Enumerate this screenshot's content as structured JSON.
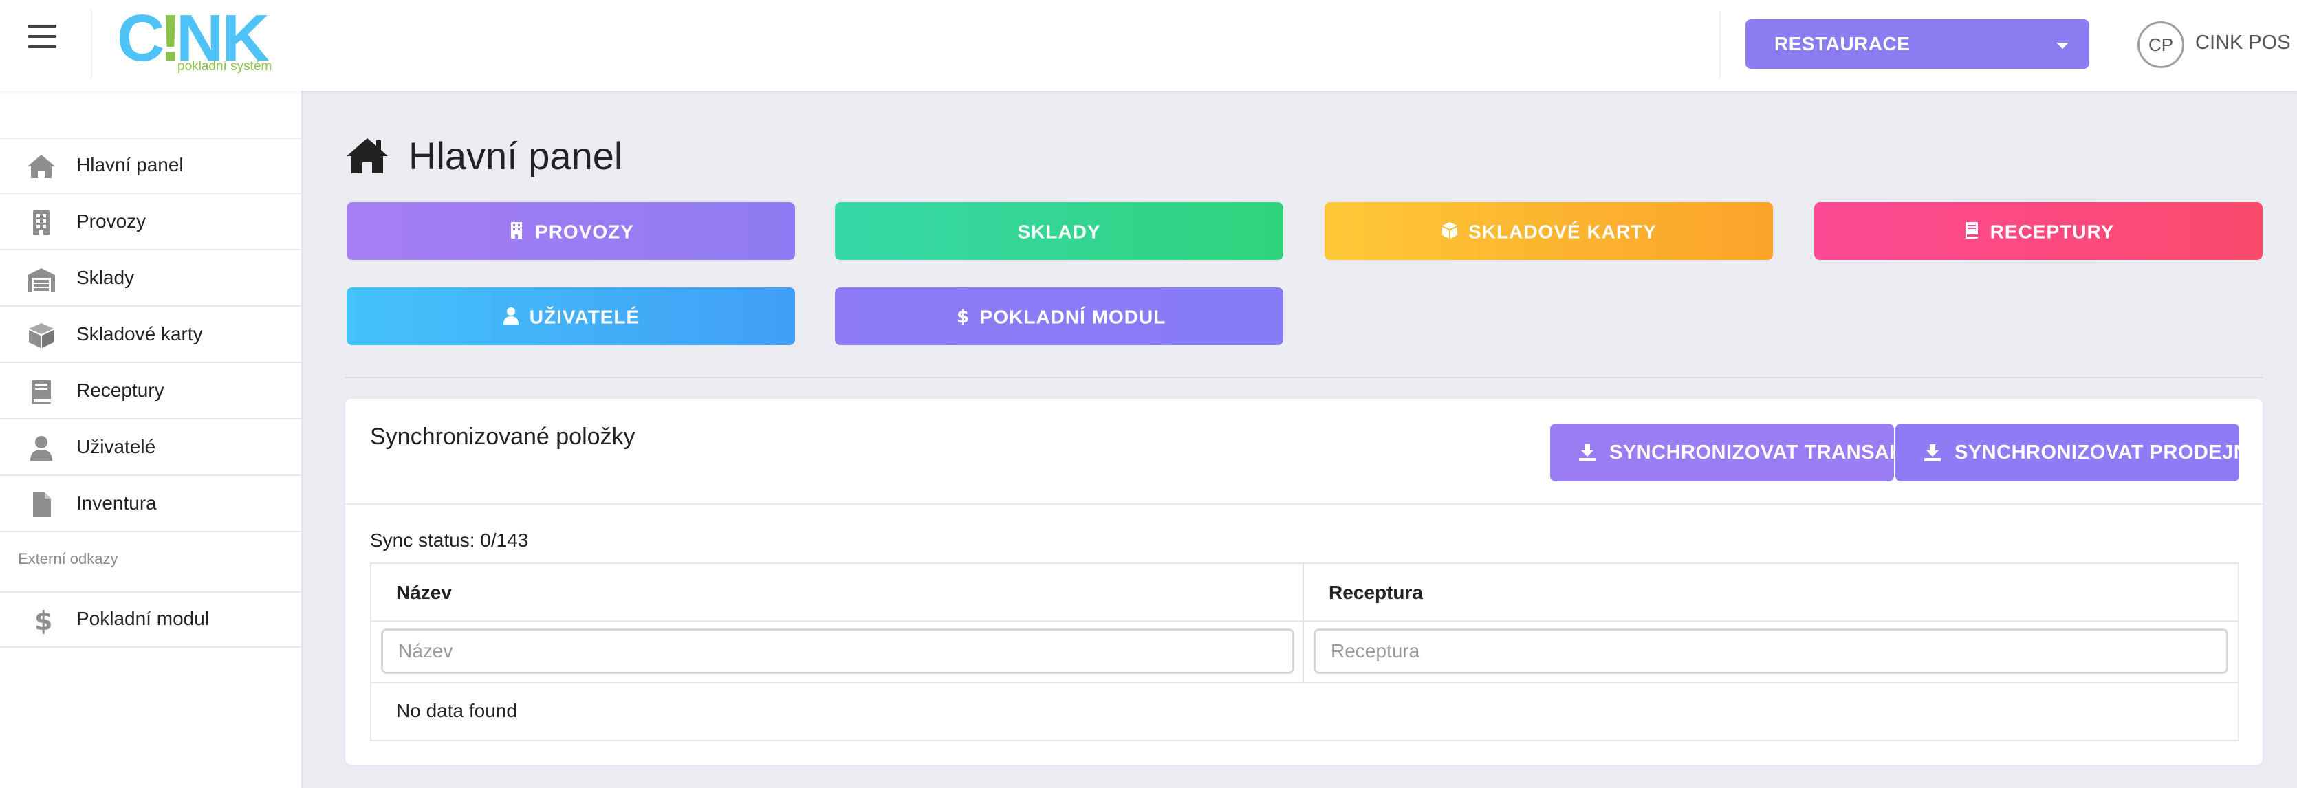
{
  "header": {
    "logo_text": "C!NK",
    "logo_tagline": "pokladní systém",
    "venue": "RESTAURACE",
    "user_initials": "CP",
    "user_name": "CINK POS"
  },
  "sidebar": {
    "items": [
      {
        "label": "Hlavní panel",
        "icon": "home-icon"
      },
      {
        "label": "Provozy",
        "icon": "building-icon"
      },
      {
        "label": "Sklady",
        "icon": "warehouse-icon"
      },
      {
        "label": "Skladové karty",
        "icon": "box-icon"
      },
      {
        "label": "Receptury",
        "icon": "book-icon"
      },
      {
        "label": "Uživatelé",
        "icon": "user-icon"
      },
      {
        "label": "Inventura",
        "icon": "file-icon"
      }
    ],
    "section_label": "Externí odkazy",
    "external_items": [
      {
        "label": "Pokladní modul",
        "icon": "dollar-icon"
      }
    ]
  },
  "page": {
    "title": "Hlavní panel"
  },
  "quick_buttons": [
    {
      "label": "PROVOZY",
      "icon": "building-icon",
      "color": "#9a7cf3"
    },
    {
      "label": "SKLADY",
      "icon": "",
      "color": "#34d39a"
    },
    {
      "label": "SKLADOVÉ KARTY",
      "icon": "box-icon",
      "color": "#fdb22f"
    },
    {
      "label": "RECEPTURY",
      "icon": "book-icon",
      "color": "#fb4a86"
    },
    {
      "label": "UŽIVATELÉ",
      "icon": "user-icon",
      "color": "#43b0f8"
    },
    {
      "label": "POKLADNÍ MODUL",
      "icon": "dollar-icon",
      "color": "#8a7cf5"
    }
  ],
  "sync_card": {
    "title": "Synchronizované položky",
    "btn_transactions": "SYNCHRONIZOVAT TRANSAKCE",
    "btn_products": "SYNCHRONIZOVAT PRODEJNÍ POLOŽKY",
    "status": "Sync status: 0/143",
    "columns": [
      "Název",
      "Receptura"
    ],
    "filters": [
      "Název",
      "Receptura"
    ],
    "empty_text": "No data found"
  }
}
